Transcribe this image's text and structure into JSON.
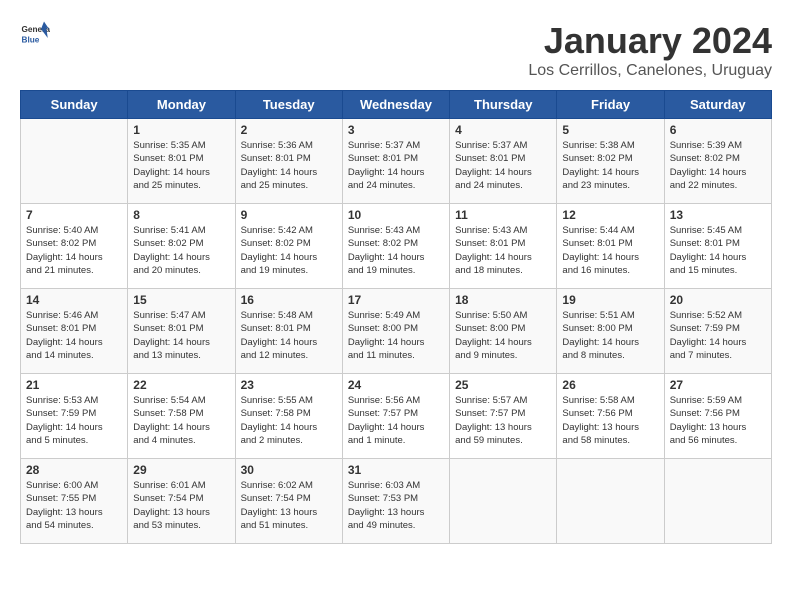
{
  "header": {
    "logo_line1": "General",
    "logo_line2": "Blue",
    "title": "January 2024",
    "subtitle": "Los Cerrillos, Canelones, Uruguay"
  },
  "days_of_week": [
    "Sunday",
    "Monday",
    "Tuesday",
    "Wednesday",
    "Thursday",
    "Friday",
    "Saturday"
  ],
  "weeks": [
    [
      {
        "day": "",
        "content": ""
      },
      {
        "day": "1",
        "content": "Sunrise: 5:35 AM\nSunset: 8:01 PM\nDaylight: 14 hours\nand 25 minutes."
      },
      {
        "day": "2",
        "content": "Sunrise: 5:36 AM\nSunset: 8:01 PM\nDaylight: 14 hours\nand 25 minutes."
      },
      {
        "day": "3",
        "content": "Sunrise: 5:37 AM\nSunset: 8:01 PM\nDaylight: 14 hours\nand 24 minutes."
      },
      {
        "day": "4",
        "content": "Sunrise: 5:37 AM\nSunset: 8:01 PM\nDaylight: 14 hours\nand 24 minutes."
      },
      {
        "day": "5",
        "content": "Sunrise: 5:38 AM\nSunset: 8:02 PM\nDaylight: 14 hours\nand 23 minutes."
      },
      {
        "day": "6",
        "content": "Sunrise: 5:39 AM\nSunset: 8:02 PM\nDaylight: 14 hours\nand 22 minutes."
      }
    ],
    [
      {
        "day": "7",
        "content": "Sunrise: 5:40 AM\nSunset: 8:02 PM\nDaylight: 14 hours\nand 21 minutes."
      },
      {
        "day": "8",
        "content": "Sunrise: 5:41 AM\nSunset: 8:02 PM\nDaylight: 14 hours\nand 20 minutes."
      },
      {
        "day": "9",
        "content": "Sunrise: 5:42 AM\nSunset: 8:02 PM\nDaylight: 14 hours\nand 19 minutes."
      },
      {
        "day": "10",
        "content": "Sunrise: 5:43 AM\nSunset: 8:02 PM\nDaylight: 14 hours\nand 19 minutes."
      },
      {
        "day": "11",
        "content": "Sunrise: 5:43 AM\nSunset: 8:01 PM\nDaylight: 14 hours\nand 18 minutes."
      },
      {
        "day": "12",
        "content": "Sunrise: 5:44 AM\nSunset: 8:01 PM\nDaylight: 14 hours\nand 16 minutes."
      },
      {
        "day": "13",
        "content": "Sunrise: 5:45 AM\nSunset: 8:01 PM\nDaylight: 14 hours\nand 15 minutes."
      }
    ],
    [
      {
        "day": "14",
        "content": "Sunrise: 5:46 AM\nSunset: 8:01 PM\nDaylight: 14 hours\nand 14 minutes."
      },
      {
        "day": "15",
        "content": "Sunrise: 5:47 AM\nSunset: 8:01 PM\nDaylight: 14 hours\nand 13 minutes."
      },
      {
        "day": "16",
        "content": "Sunrise: 5:48 AM\nSunset: 8:01 PM\nDaylight: 14 hours\nand 12 minutes."
      },
      {
        "day": "17",
        "content": "Sunrise: 5:49 AM\nSunset: 8:00 PM\nDaylight: 14 hours\nand 11 minutes."
      },
      {
        "day": "18",
        "content": "Sunrise: 5:50 AM\nSunset: 8:00 PM\nDaylight: 14 hours\nand 9 minutes."
      },
      {
        "day": "19",
        "content": "Sunrise: 5:51 AM\nSunset: 8:00 PM\nDaylight: 14 hours\nand 8 minutes."
      },
      {
        "day": "20",
        "content": "Sunrise: 5:52 AM\nSunset: 7:59 PM\nDaylight: 14 hours\nand 7 minutes."
      }
    ],
    [
      {
        "day": "21",
        "content": "Sunrise: 5:53 AM\nSunset: 7:59 PM\nDaylight: 14 hours\nand 5 minutes."
      },
      {
        "day": "22",
        "content": "Sunrise: 5:54 AM\nSunset: 7:58 PM\nDaylight: 14 hours\nand 4 minutes."
      },
      {
        "day": "23",
        "content": "Sunrise: 5:55 AM\nSunset: 7:58 PM\nDaylight: 14 hours\nand 2 minutes."
      },
      {
        "day": "24",
        "content": "Sunrise: 5:56 AM\nSunset: 7:57 PM\nDaylight: 14 hours\nand 1 minute."
      },
      {
        "day": "25",
        "content": "Sunrise: 5:57 AM\nSunset: 7:57 PM\nDaylight: 13 hours\nand 59 minutes."
      },
      {
        "day": "26",
        "content": "Sunrise: 5:58 AM\nSunset: 7:56 PM\nDaylight: 13 hours\nand 58 minutes."
      },
      {
        "day": "27",
        "content": "Sunrise: 5:59 AM\nSunset: 7:56 PM\nDaylight: 13 hours\nand 56 minutes."
      }
    ],
    [
      {
        "day": "28",
        "content": "Sunrise: 6:00 AM\nSunset: 7:55 PM\nDaylight: 13 hours\nand 54 minutes."
      },
      {
        "day": "29",
        "content": "Sunrise: 6:01 AM\nSunset: 7:54 PM\nDaylight: 13 hours\nand 53 minutes."
      },
      {
        "day": "30",
        "content": "Sunrise: 6:02 AM\nSunset: 7:54 PM\nDaylight: 13 hours\nand 51 minutes."
      },
      {
        "day": "31",
        "content": "Sunrise: 6:03 AM\nSunset: 7:53 PM\nDaylight: 13 hours\nand 49 minutes."
      },
      {
        "day": "",
        "content": ""
      },
      {
        "day": "",
        "content": ""
      },
      {
        "day": "",
        "content": ""
      }
    ]
  ]
}
